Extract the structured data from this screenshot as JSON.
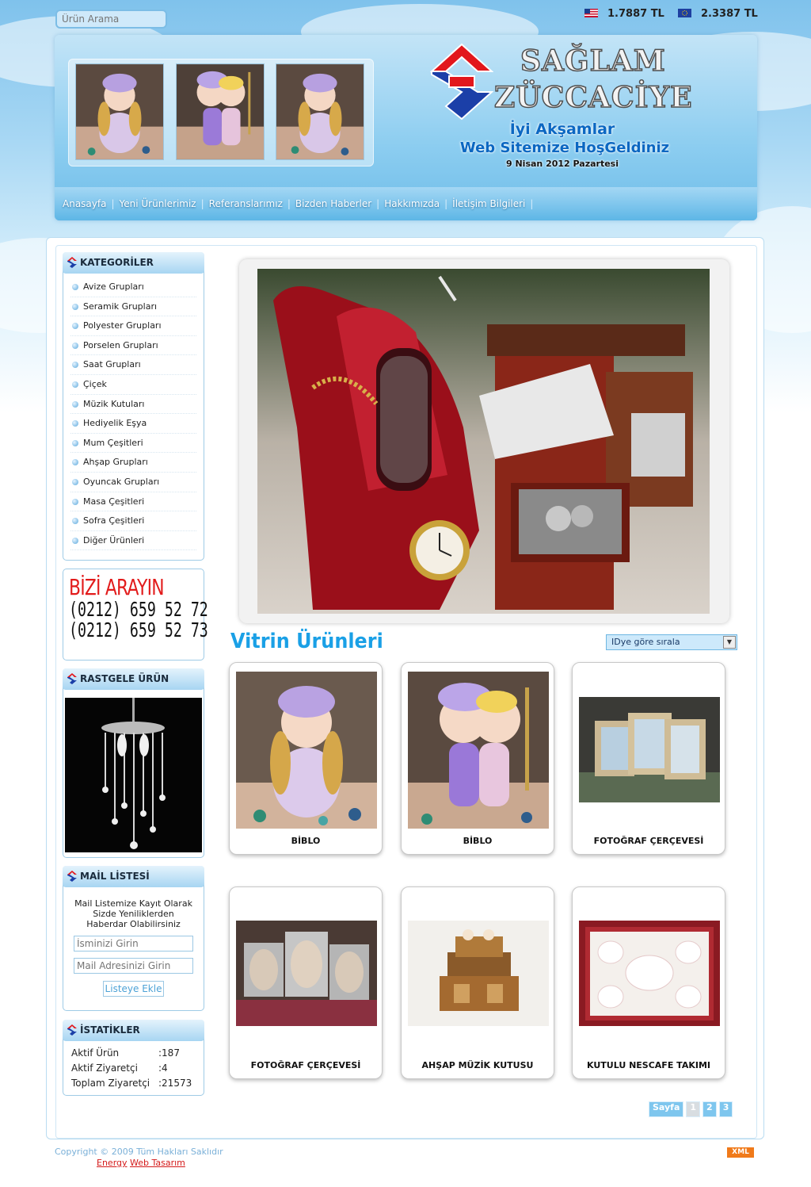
{
  "search": {
    "placeholder": "Ürün Arama"
  },
  "currency": {
    "usd": {
      "icon": "us-flag-icon",
      "value": "1.7887 TL"
    },
    "eur": {
      "icon": "eu-flag-icon",
      "value": "2.3387 TL"
    }
  },
  "brand": {
    "line1": "SAĞLAM",
    "line2": "ZÜCCACİYE",
    "colors": {
      "red": "#e2171c",
      "blue": "#1b3fa8"
    }
  },
  "greeting": {
    "line1": "İyi Akşamlar",
    "line2": "Web Sitemize HoşGeldiniz",
    "date": "9 Nisan 2012 Pazartesi"
  },
  "nav": [
    "Anasayfa",
    "Yeni Ürünlerimiz",
    "Referanslarımız",
    "Bizden Haberler",
    "Hakkımızda",
    "İletişim Bilgileri"
  ],
  "categories": {
    "title": "KATEGORİLER",
    "items": [
      "Avize Grupları",
      "Seramik Grupları",
      "Polyester Grupları",
      "Porselen Grupları",
      "Saat Grupları",
      "Çiçek",
      "Müzik Kutuları",
      "Hediyelik Eşya",
      "Mum Çeşitleri",
      "Ahşap Grupları",
      "Oyuncak Grupları",
      "Masa Çeşitleri",
      "Sofra Çeşitleri",
      "Diğer Ürünleri"
    ]
  },
  "call": {
    "title": "BİZİ ARAYIN",
    "phone1": "(0212) 659 52 72",
    "phone2": "(0212) 659 52 73"
  },
  "random_product": {
    "title": "RASTGELE ÜRÜN"
  },
  "mail": {
    "title": "MAİL LİSTESİ",
    "text": "Mail Listemize Kayıt Olarak Sizde Yeniliklerden Haberdar Olabilirsiniz",
    "name_placeholder": "İsminizi Girin",
    "email_placeholder": "Mail Adresinizi Girin",
    "button": "Listeye Ekle"
  },
  "stats": {
    "title": "İSTATİKLER",
    "rows": [
      {
        "label": "Aktif Ürün",
        "value": ":187"
      },
      {
        "label": "Aktif Ziyaretçi",
        "value": ":4"
      },
      {
        "label": "Toplam Ziyaretçi",
        "value": ":21573"
      }
    ]
  },
  "showcase": {
    "title": "Vitrin Ürünleri",
    "sort_selected": "IDye göre sırala"
  },
  "products": [
    "BİBLO",
    "BİBLO",
    "FOTOĞRAF ÇERÇEVESİ",
    "FOTOĞRAF ÇERÇEVESİ",
    "AHŞAP MÜZİK KUTUSU",
    "KUTULU NESCAFE TAKIMI"
  ],
  "pager": {
    "label": "Sayfa",
    "pages": [
      "1",
      "2",
      "3"
    ]
  },
  "footer": {
    "copyright": "Copyright © 2009 Tüm Hakları Saklıdır",
    "link1": "Energy",
    "link2": "Web Tasarım",
    "xml": "XML"
  }
}
